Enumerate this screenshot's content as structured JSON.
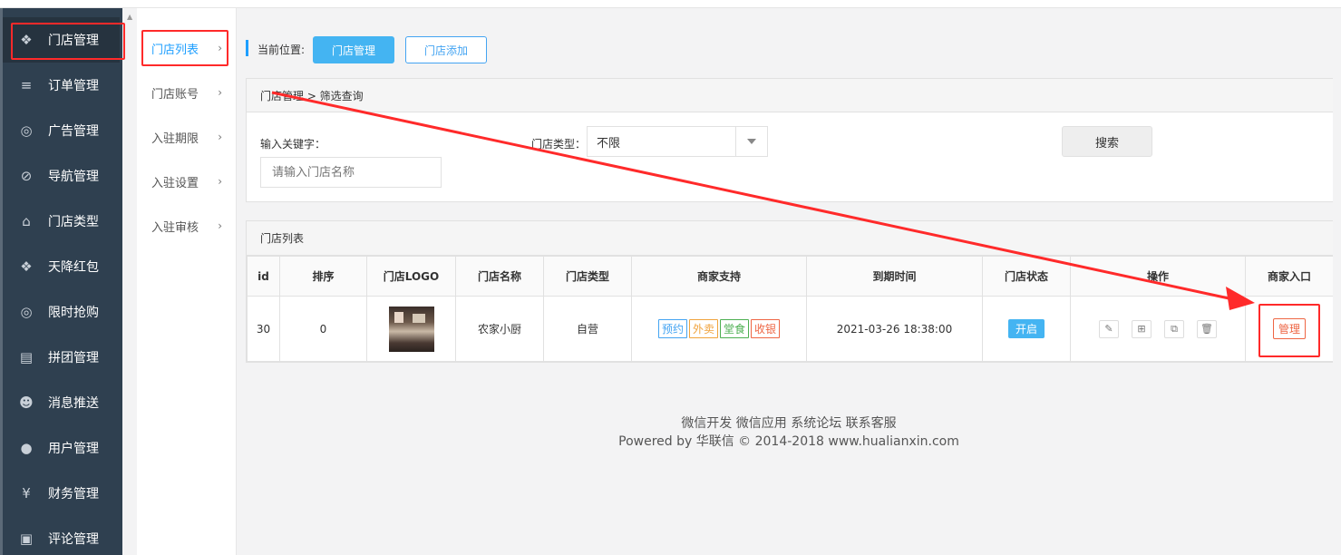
{
  "sidebar": {
    "items": [
      {
        "label": "门店管理",
        "icon": "cubes-icon",
        "glyph": "❖"
      },
      {
        "label": "订单管理",
        "icon": "list-icon",
        "glyph": "≡"
      },
      {
        "label": "广告管理",
        "icon": "lifebuoy-icon",
        "glyph": "◎"
      },
      {
        "label": "导航管理",
        "icon": "compass-icon",
        "glyph": "⊘"
      },
      {
        "label": "门店类型",
        "icon": "bank-icon",
        "glyph": "⌂"
      },
      {
        "label": "天降红包",
        "icon": "cubes-icon",
        "glyph": "❖"
      },
      {
        "label": "限时抢购",
        "icon": "lifebuoy-icon",
        "glyph": "◎"
      },
      {
        "label": "拼团管理",
        "icon": "newspaper-icon",
        "glyph": "▤"
      },
      {
        "label": "消息推送",
        "icon": "users-icon",
        "glyph": "☻"
      },
      {
        "label": "用户管理",
        "icon": "user-icon",
        "glyph": "●"
      },
      {
        "label": "财务管理",
        "icon": "yen-icon",
        "glyph": "¥"
      },
      {
        "label": "评论管理",
        "icon": "money-icon",
        "glyph": "▣"
      }
    ]
  },
  "subnav": {
    "items": [
      {
        "label": "门店列表"
      },
      {
        "label": "门店账号"
      },
      {
        "label": "入驻期限"
      },
      {
        "label": "入驻设置"
      },
      {
        "label": "入驻审核"
      }
    ],
    "chevron": "›"
  },
  "breadcrumb": {
    "label": "当前位置:",
    "current": "门店管理",
    "add": "门店添加"
  },
  "filter": {
    "title": "门店管理 > 筛选查询",
    "keyword_label": "输入关键字：",
    "keyword_placeholder": "请输入门店名称",
    "type_label": "门店类型：",
    "type_value": "不限",
    "search_label": "搜索"
  },
  "list": {
    "title": "门店列表",
    "columns": [
      "id",
      "排序",
      "门店LOGO",
      "门店名称",
      "门店类型",
      "商家支持",
      "到期时间",
      "门店状态",
      "操作",
      "商家入口"
    ],
    "rows": [
      {
        "id": "30",
        "sort": "0",
        "name": "农家小厨",
        "type": "自营",
        "supports": [
          {
            "label": "预约",
            "color": "#44a4f2"
          },
          {
            "label": "外卖",
            "color": "#f0a33c"
          },
          {
            "label": "堂食",
            "color": "#4caf50"
          },
          {
            "label": "收银",
            "color": "#ee6644"
          }
        ],
        "expire": "2021-03-26 18:38:00",
        "status": "开启",
        "ops": [
          {
            "icon": "pencil-icon",
            "glyph": "✎"
          },
          {
            "icon": "qrcode-icon",
            "glyph": "⊞"
          },
          {
            "icon": "copy-icon",
            "glyph": "⧉"
          },
          {
            "icon": "trash-icon",
            "glyph": "🗑"
          }
        ],
        "manage": "管理"
      }
    ]
  },
  "footer": {
    "links": "微信开发 微信应用 系统论坛 联系客服",
    "copyright": "Powered by 华联信 © 2014-2018 www.hualianxin.com"
  },
  "colors": {
    "sidebar_bg": "#2f4050",
    "accent": "#44b4f2",
    "annotation": "#ff2a2a"
  }
}
